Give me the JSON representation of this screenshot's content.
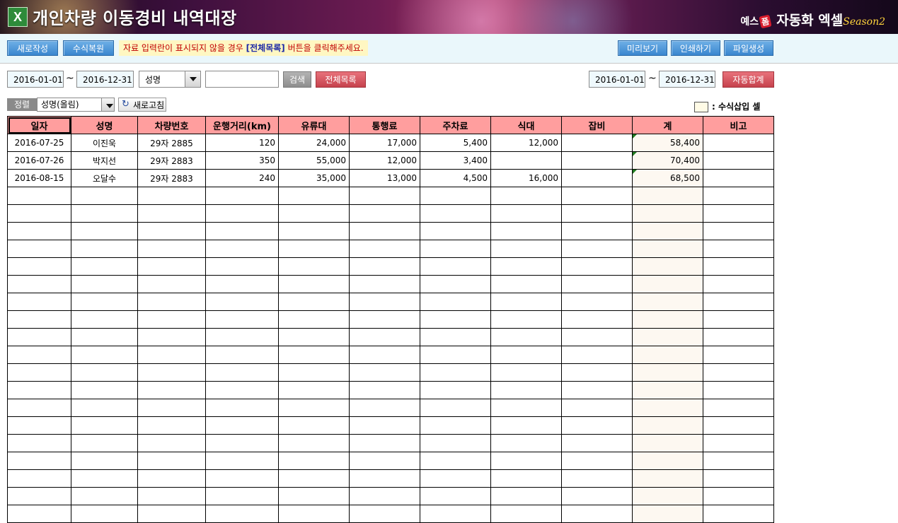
{
  "banner": {
    "icon": "X",
    "title": "개인차량 이동경비 내역대장",
    "brand_prefix": "예스",
    "brand_plus": "폼",
    "brand_name": "자동화 엑셀",
    "brand_season": "Season2"
  },
  "toolbar": {
    "new_label": "새로작성",
    "restore_label": "수식복원",
    "notice_text": "자료 입력란이 표시되지  않을 경우 ",
    "notice_button_ref": "[전체목록]",
    "notice_suffix": " 버튼을 클릭해주세요.",
    "preview_label": "미리보기",
    "print_label": "인쇄하기",
    "file_label": "파일생성"
  },
  "filter": {
    "date_from": "2016-01-01",
    "tilde": "~",
    "date_to": "2016-12-31",
    "field_select": "성명",
    "search_value": "",
    "search_label": "검색",
    "all_list_label": "전체목록",
    "sum_date_from": "2016-01-01",
    "sum_date_to": "2016-12-31",
    "auto_sum_label": "자동합계"
  },
  "sort": {
    "label": "정렬",
    "value": "성명(올림)",
    "refresh_label": "새로고침"
  },
  "legend": {
    "text": ": 수식삽입 셀",
    "color": "#fffbe6"
  },
  "table": {
    "headers": [
      "일자",
      "성명",
      "차량번호",
      "운행거리(km)",
      "유류대",
      "통행료",
      "주차료",
      "식대",
      "잡비",
      "계",
      "비고"
    ],
    "rows": [
      [
        "2016-07-25",
        "이진욱",
        "29자 2885",
        "120",
        "24,000",
        "17,000",
        "5,400",
        "12,000",
        "",
        "58,400",
        ""
      ],
      [
        "2016-07-26",
        "박지선",
        "29자 2883",
        "350",
        "55,000",
        "12,000",
        "3,400",
        "",
        "",
        "70,400",
        ""
      ],
      [
        "2016-08-15",
        "오달수",
        "29자 2883",
        "240",
        "35,000",
        "13,000",
        "4,500",
        "16,000",
        "",
        "68,500",
        ""
      ]
    ]
  },
  "colors": {
    "header_bg": "#ff9e9e",
    "toolbar_bg": "#eaf7fb",
    "button_blue": "#3a86cf",
    "button_red": "#c6424d"
  }
}
